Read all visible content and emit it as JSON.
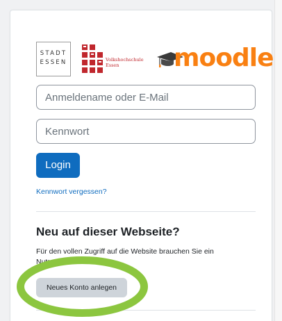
{
  "logos": {
    "stadt_line1": "STADT",
    "stadt_line2": "ESSEN",
    "vhs_line1": "Volkshochschule",
    "vhs_line2": "Essen",
    "moodle_text": "moodle"
  },
  "login": {
    "username_placeholder": "Anmeldename oder E-Mail",
    "password_placeholder": "Kennwort",
    "login_label": "Login",
    "forgot_label": "Kennwort vergessen?"
  },
  "signup": {
    "heading": "Neu auf dieser Webseite?",
    "text": "Für den vollen Zugriff auf die Website brauchen Sie ein Nutzerkonto.",
    "button_label": "Neues Konto anlegen"
  },
  "colors": {
    "primary": "#0f6cbf",
    "moodle_orange": "#f98012",
    "vhs_red": "#c0272d",
    "highlight_green": "#8cc63f",
    "secondary_button": "#ced4da"
  }
}
